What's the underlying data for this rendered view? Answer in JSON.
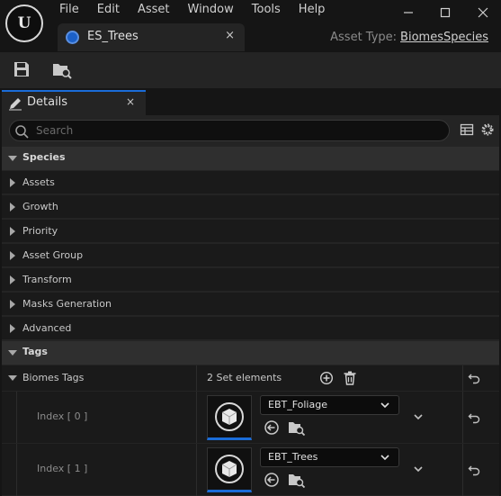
{
  "app": {
    "logo_letter": "U"
  },
  "menu": [
    "File",
    "Edit",
    "Asset",
    "Window",
    "Tools",
    "Help"
  ],
  "window_controls": {
    "minimize": "─",
    "maximize": "☐",
    "close": "✕"
  },
  "tab": {
    "label": "ES_Trees",
    "close": "×"
  },
  "asset_type": {
    "label": "Asset Type:",
    "value": "BiomesSpecies"
  },
  "details": {
    "tab_label": "Details",
    "close": "×",
    "search_placeholder": "Search"
  },
  "categories": {
    "species": {
      "label": "Species",
      "expanded": true
    },
    "tags": {
      "label": "Tags",
      "expanded": true
    }
  },
  "species_items": [
    "Assets",
    "Growth",
    "Priority",
    "Asset Group",
    "Transform",
    "Masks Generation",
    "Advanced"
  ],
  "biomes_tags": {
    "label": "Biomes Tags",
    "count_text": "2 Set elements",
    "elements": [
      {
        "index": "Index [ 0 ]",
        "value": "EBT_Foliage"
      },
      {
        "index": "Index [ 1 ]",
        "value": "EBT_Trees"
      }
    ]
  },
  "colors": {
    "accent": "#1a6cd8",
    "panel": "#242424",
    "row": "#1a1a1a",
    "category": "#2f2f2f"
  }
}
